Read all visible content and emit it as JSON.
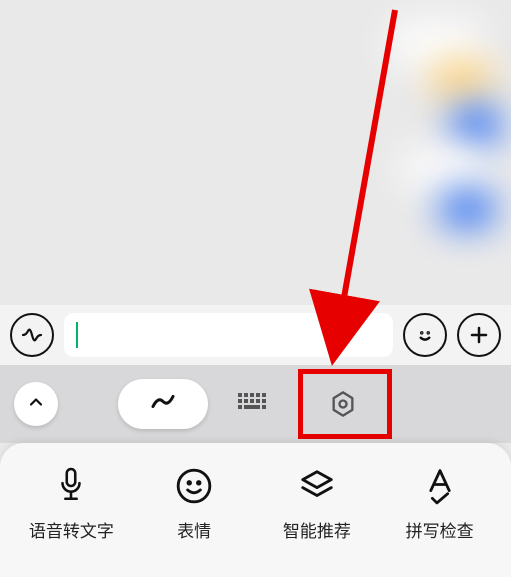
{
  "input": {
    "value": ""
  },
  "toolbar": {
    "segments": [
      {
        "id": "handwriting",
        "icon": "handwriting-icon",
        "active": true
      },
      {
        "id": "keyboard",
        "icon": "keyboard-icon",
        "active": false
      },
      {
        "id": "settings",
        "icon": "settings-hex-icon",
        "active": false
      }
    ]
  },
  "keyboard_panel": {
    "items": [
      {
        "label": "语音转文字",
        "icon": "mic-icon"
      },
      {
        "label": "表情",
        "icon": "emoji-icon"
      },
      {
        "label": "智能推荐",
        "icon": "stack-icon"
      },
      {
        "label": "拼写检查",
        "icon": "spellcheck-icon"
      }
    ]
  },
  "annotation": {
    "arrow_color": "#e60000",
    "highlight_target": "settings"
  }
}
